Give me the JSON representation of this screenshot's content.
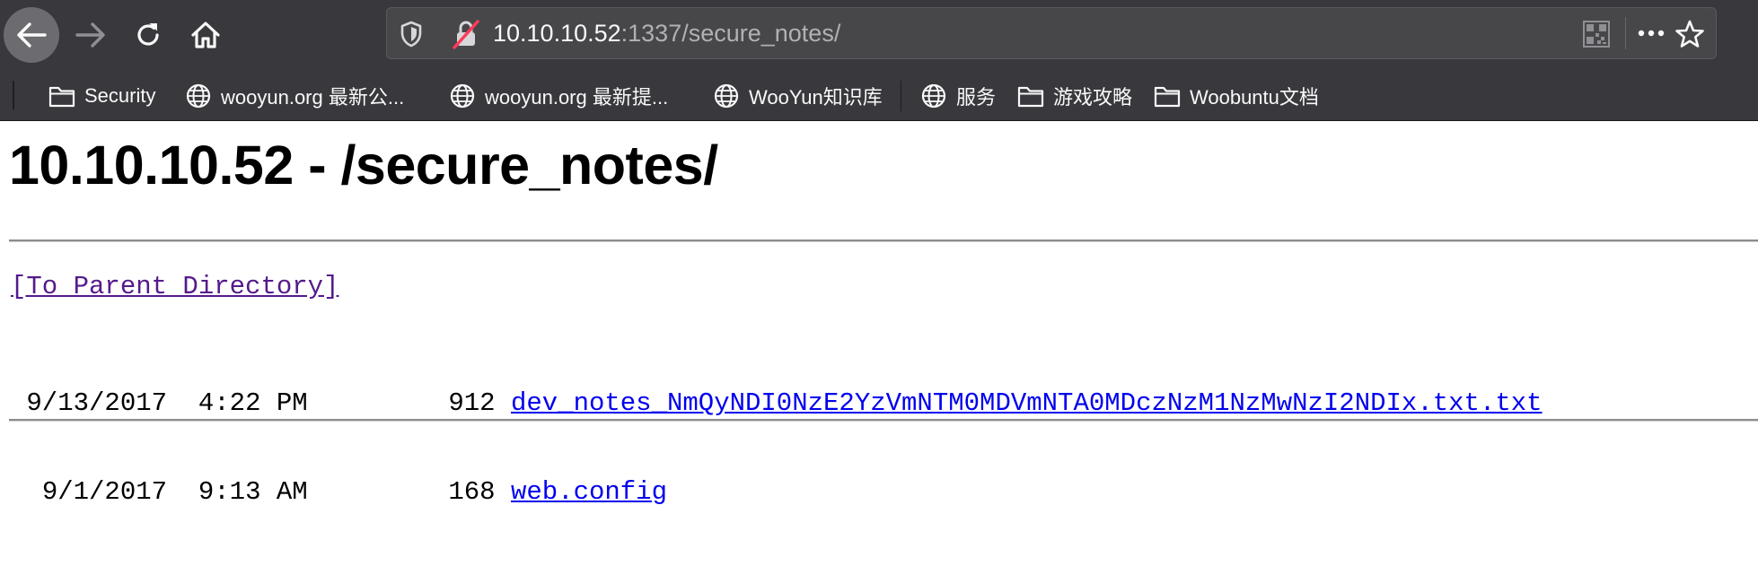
{
  "browser": {
    "url_host": "10.10.10.52",
    "url_path": ":1337/secure_notes/",
    "bookmarks": [
      {
        "label": "Security",
        "icon": "folder-icon"
      },
      {
        "label": "wooyun.org 最新公...",
        "icon": "globe-icon"
      },
      {
        "label": "wooyun.org 最新提...",
        "icon": "globe-icon"
      },
      {
        "label": "WooYun知识库",
        "icon": "globe-icon"
      },
      {
        "label": "服务",
        "icon": "globe-icon"
      },
      {
        "label": "游戏攻略",
        "icon": "folder-icon"
      },
      {
        "label": "Woobuntu文档",
        "icon": "folder-icon"
      }
    ]
  },
  "page": {
    "title": "10.10.10.52 - /secure_notes/",
    "parent_link": "[To Parent Directory]",
    "files": [
      {
        "date": "9/13/2017",
        "time": "4:22 PM",
        "size": "912",
        "name": "dev_notes_NmQyNDI0NzE2YzVmNTM0MDVmNTA0MDczNzM1NzMwNzI2NDIx.txt.txt"
      },
      {
        "date": "9/1/2017",
        "time": "9:13 AM",
        "size": "168",
        "name": "web.config"
      }
    ]
  },
  "colors": {
    "chrome_bg": "#38383d",
    "urlbar_bg": "#474749",
    "link": "#0000ee",
    "visited_link": "#551a8b"
  }
}
